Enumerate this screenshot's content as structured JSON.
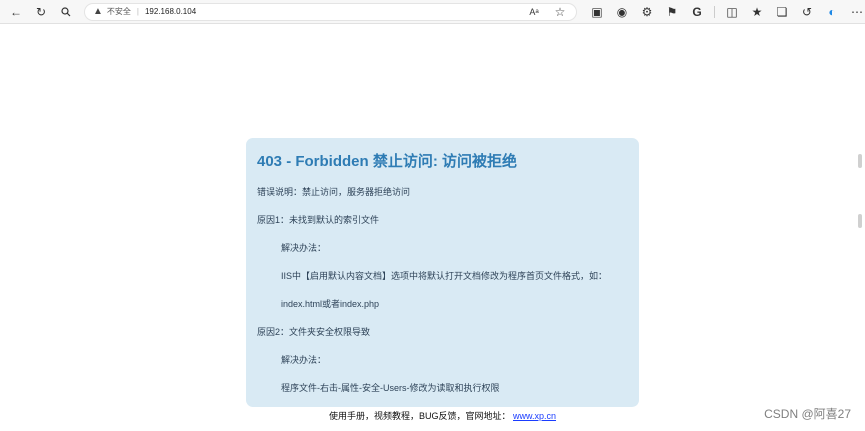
{
  "browser": {
    "address": {
      "security_text": "不安全",
      "url": "192.168.0.104"
    }
  },
  "page": {
    "title": "403 - Forbidden 禁止访问: 访问被拒绝",
    "lines": [
      "错误说明：禁止访问，服务器拒绝访问",
      "原因1：未找到默认的索引文件",
      "解决办法：",
      "IIS中【启用默认内容文档】选项中将默认打开文档修改为程序首页文件格式，如：",
      "index.html或者index.php",
      "原因2：文件夹安全权限导致",
      "解决办法：",
      "程序文件-右击-属性-安全-Users-修改为读取和执行权限"
    ],
    "footer_text": "使用手册，视频教程，BUG反馈，官网地址：",
    "footer_link": "www.xp.cn"
  },
  "watermark": "CSDN @阿喜27",
  "colors": {
    "card_bg": "#d9eaf4",
    "title": "#2e7cb4",
    "link": "#1a3cff"
  }
}
